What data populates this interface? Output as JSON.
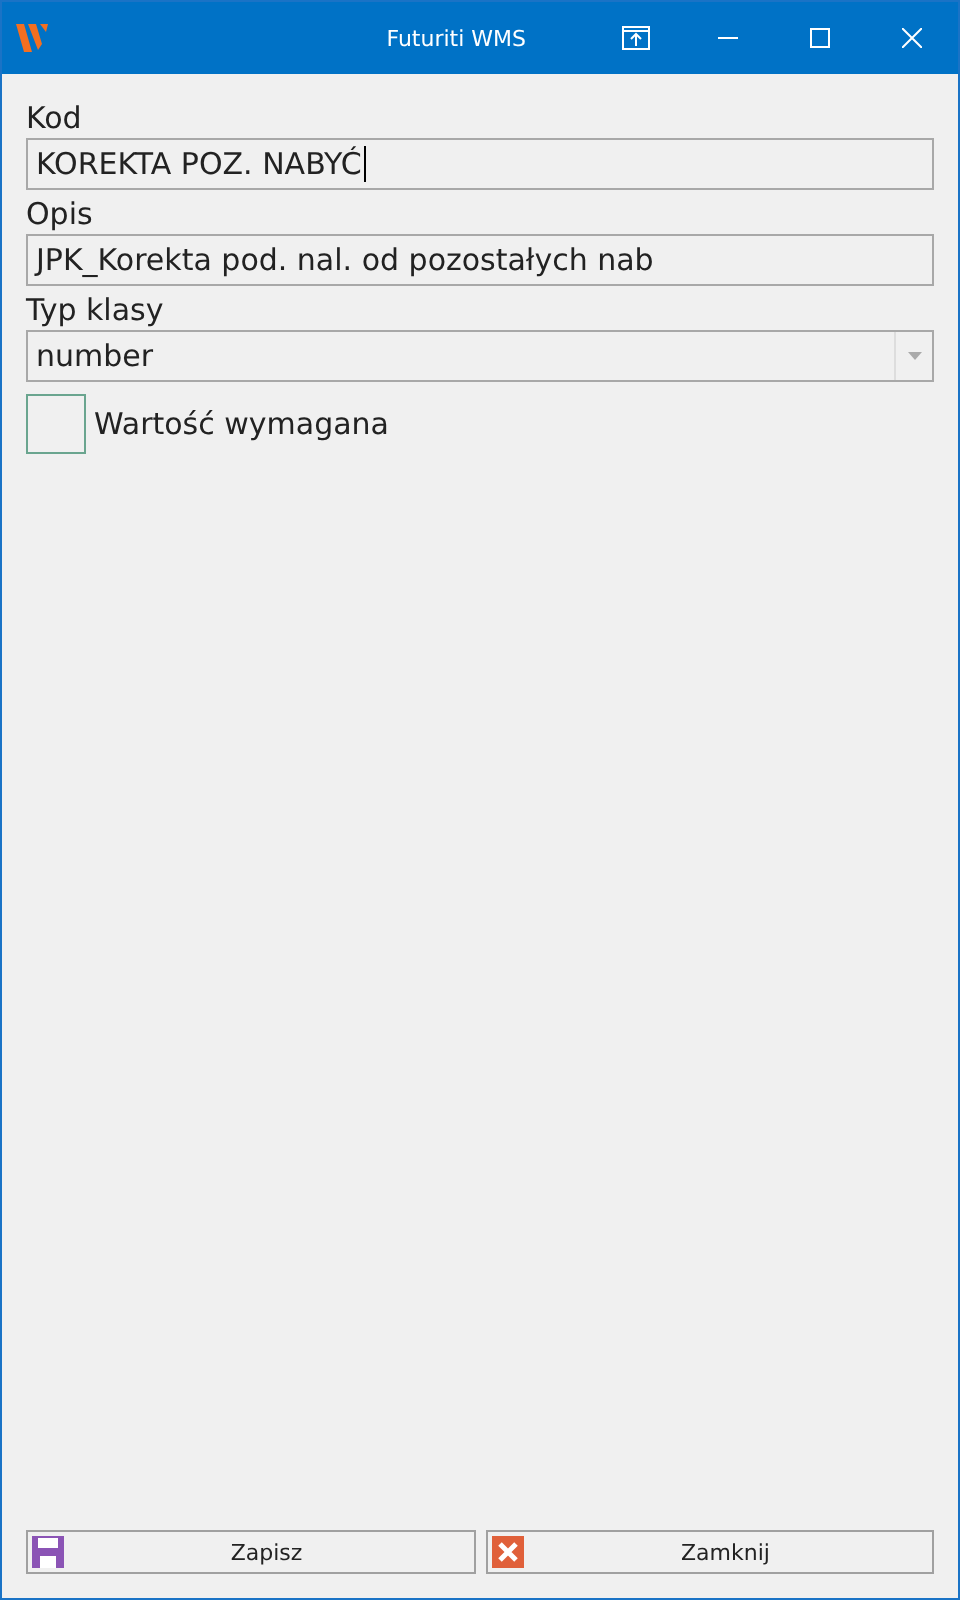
{
  "window": {
    "title": "Futuriti WMS"
  },
  "fields": [
    {
      "label": "Kod",
      "value": "KOREKTA POZ. NABYĆ",
      "kind": "text",
      "focused": true
    },
    {
      "label": "Opis",
      "value": "JPK_Korekta pod. nal. od pozostałych nab",
      "kind": "text",
      "focused": false
    },
    {
      "label": "Typ klasy",
      "value": "number",
      "kind": "select",
      "focused": false
    }
  ],
  "checkbox": {
    "label": "Wartość wymagana",
    "checked": false
  },
  "buttons": [
    {
      "label": "Zapisz",
      "kind": "save"
    },
    {
      "label": "Zamknij",
      "kind": "close"
    }
  ]
}
